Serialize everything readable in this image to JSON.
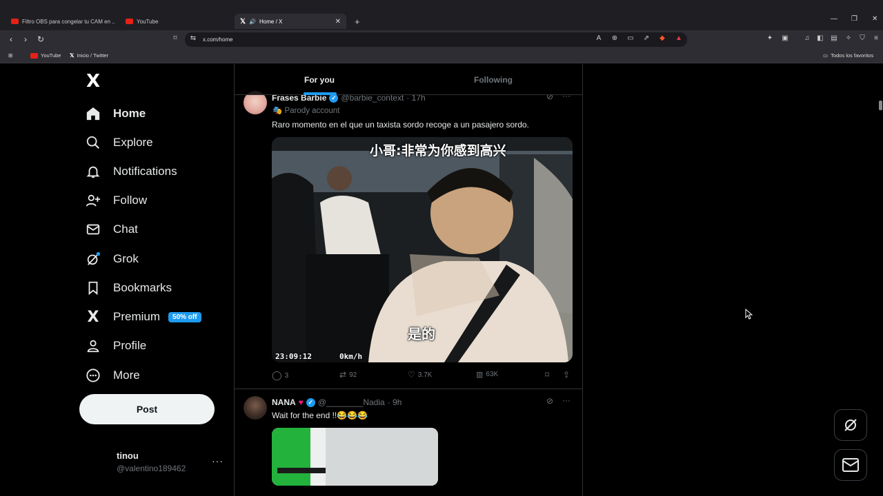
{
  "browser": {
    "tabs": [
      {
        "title": "Filtro OBS para congelar tu CAM en ..."
      },
      {
        "title": "YouTube"
      },
      {
        "title": "Home / X"
      }
    ],
    "new_tab": "+",
    "url": "x.com/home",
    "bookmarks": [
      {
        "label": "YouTube"
      },
      {
        "label": "Inicio / Twitter"
      }
    ],
    "all_bookmarks": "Todos los favoritos"
  },
  "sidebar": {
    "logo": "X",
    "items": [
      {
        "label": "Home",
        "icon": "home-icon"
      },
      {
        "label": "Explore",
        "icon": "search-icon"
      },
      {
        "label": "Notifications",
        "icon": "bell-icon"
      },
      {
        "label": "Follow",
        "icon": "follow-icon"
      },
      {
        "label": "Chat",
        "icon": "mail-icon"
      },
      {
        "label": "Grok",
        "icon": "grok-icon"
      },
      {
        "label": "Bookmarks",
        "icon": "bookmark-icon"
      },
      {
        "label": "Premium",
        "icon": "x-icon",
        "badge": "50% off"
      },
      {
        "label": "Profile",
        "icon": "person-icon"
      },
      {
        "label": "More",
        "icon": "more-circle-icon"
      }
    ],
    "post_button": "Post",
    "user": {
      "name": "tinou",
      "handle": "@valentino189462",
      "more": "···"
    }
  },
  "feed": {
    "tabs": [
      {
        "label": "For you",
        "active": true
      },
      {
        "label": "Following",
        "active": false
      }
    ],
    "tweets": [
      {
        "name": "Frases Barbie",
        "handle": "@barbie_context",
        "time": "· 17h",
        "label": "Parody account",
        "text": "Raro momento en el que un taxista sordo recoge a un pasajero sordo.",
        "media": {
          "subtitle_top": "小哥:非常为你感到高兴",
          "subtitle_bottom": "是的",
          "timestamp": "23:09:12",
          "speed": "0km/h"
        },
        "stats": {
          "replies": "3",
          "reposts": "92",
          "likes": "3.7K",
          "views": "63K"
        }
      },
      {
        "name": "NANA",
        "handle": "@________Nadia",
        "time": "· 9h",
        "text": "Wait for the end !!😂😂😂"
      }
    ]
  },
  "colors": {
    "accent": "#1d9bf0",
    "background": "#000000",
    "border": "#2f3336",
    "muted": "#71767b"
  }
}
